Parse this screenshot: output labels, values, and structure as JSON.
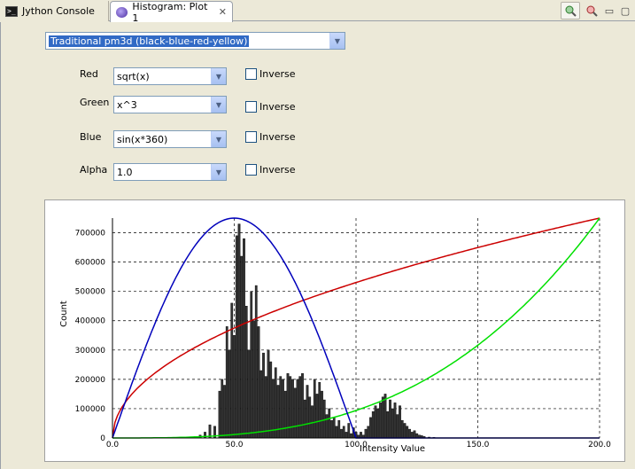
{
  "tabs": [
    {
      "label": "Jython Console",
      "active": false
    },
    {
      "label": "Histogram: Plot 1",
      "active": true
    }
  ],
  "colormap": {
    "selected": "Traditional pm3d (black-blue-red-yellow)"
  },
  "channels": [
    {
      "label": "Red",
      "function": "sqrt(x)",
      "inverse_label": "Inverse",
      "inverse": false
    },
    {
      "label": "Green",
      "function": "x^3",
      "inverse_label": "Inverse",
      "inverse": false
    },
    {
      "label": "Blue",
      "function": "sin(x*360)",
      "inverse_label": "Inverse",
      "inverse": false
    },
    {
      "label": "Alpha",
      "function": "1.0",
      "inverse_label": "Inverse",
      "inverse": false
    }
  ],
  "colors": {
    "red_curve": "#cc0000",
    "green_curve": "#00e000",
    "blue_curve": "#0000bb",
    "bars": "#333333"
  },
  "chart_data": {
    "type": "bar",
    "title": "",
    "xlabel": "Intensity Value",
    "ylabel": "Count",
    "xlim": [
      0,
      200
    ],
    "ylim": [
      0,
      750000
    ],
    "x_ticks": [
      "0.0",
      "50.0",
      "100.0",
      "150.0",
      "200.0"
    ],
    "y_ticks": [
      "0",
      "100000",
      "200000",
      "300000",
      "400000",
      "500000",
      "600000",
      "700000"
    ],
    "grid": true,
    "bins": [
      [
        28,
        2000
      ],
      [
        30,
        3000
      ],
      [
        32,
        4000
      ],
      [
        34,
        5000
      ],
      [
        36,
        10000
      ],
      [
        38,
        20000
      ],
      [
        40,
        45000
      ],
      [
        42,
        40000
      ],
      [
        44,
        160000
      ],
      [
        45,
        200000
      ],
      [
        46,
        180000
      ],
      [
        47,
        380000
      ],
      [
        48,
        300000
      ],
      [
        49,
        460000
      ],
      [
        50,
        350000
      ],
      [
        51,
        690000
      ],
      [
        52,
        730000
      ],
      [
        53,
        620000
      ],
      [
        54,
        680000
      ],
      [
        55,
        450000
      ],
      [
        56,
        300000
      ],
      [
        57,
        500000
      ],
      [
        58,
        400000
      ],
      [
        59,
        520000
      ],
      [
        60,
        380000
      ],
      [
        61,
        230000
      ],
      [
        62,
        290000
      ],
      [
        63,
        210000
      ],
      [
        64,
        300000
      ],
      [
        65,
        260000
      ],
      [
        66,
        200000
      ],
      [
        67,
        240000
      ],
      [
        68,
        180000
      ],
      [
        69,
        210000
      ],
      [
        70,
        200000
      ],
      [
        71,
        160000
      ],
      [
        72,
        220000
      ],
      [
        73,
        210000
      ],
      [
        74,
        200000
      ],
      [
        75,
        170000
      ],
      [
        76,
        200000
      ],
      [
        77,
        210000
      ],
      [
        78,
        220000
      ],
      [
        79,
        130000
      ],
      [
        80,
        180000
      ],
      [
        81,
        140000
      ],
      [
        82,
        110000
      ],
      [
        83,
        200000
      ],
      [
        84,
        150000
      ],
      [
        85,
        190000
      ],
      [
        86,
        160000
      ],
      [
        87,
        130000
      ],
      [
        88,
        80000
      ],
      [
        89,
        100000
      ],
      [
        90,
        60000
      ],
      [
        91,
        70000
      ],
      [
        92,
        40000
      ],
      [
        93,
        60000
      ],
      [
        94,
        30000
      ],
      [
        95,
        40000
      ],
      [
        96,
        20000
      ],
      [
        97,
        50000
      ],
      [
        98,
        15000
      ],
      [
        99,
        35000
      ],
      [
        100,
        20000
      ],
      [
        101,
        10000
      ],
      [
        102,
        20000
      ],
      [
        103,
        10000
      ],
      [
        104,
        30000
      ],
      [
        105,
        40000
      ],
      [
        106,
        70000
      ],
      [
        107,
        90000
      ],
      [
        108,
        110000
      ],
      [
        109,
        100000
      ],
      [
        110,
        120000
      ],
      [
        111,
        140000
      ],
      [
        112,
        150000
      ],
      [
        113,
        90000
      ],
      [
        114,
        130000
      ],
      [
        115,
        100000
      ],
      [
        116,
        120000
      ],
      [
        117,
        80000
      ],
      [
        118,
        110000
      ],
      [
        119,
        60000
      ],
      [
        120,
        50000
      ],
      [
        121,
        40000
      ],
      [
        122,
        30000
      ],
      [
        123,
        20000
      ],
      [
        124,
        25000
      ],
      [
        125,
        15000
      ],
      [
        126,
        10000
      ],
      [
        127,
        8000
      ],
      [
        128,
        5000
      ],
      [
        130,
        3000
      ],
      [
        132,
        2000
      ]
    ],
    "curves": [
      {
        "name": "sqrt(x)",
        "color": "#cc0000"
      },
      {
        "name": "x^3",
        "color": "#00e000"
      },
      {
        "name": "sin(x*360)",
        "color": "#0000bb"
      }
    ]
  }
}
